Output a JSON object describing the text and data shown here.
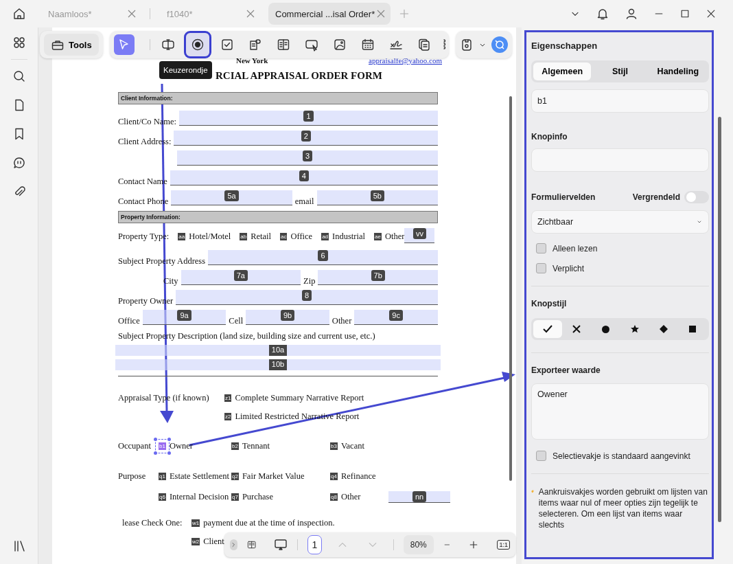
{
  "tabs": [
    {
      "label": "Naamloos*",
      "selected": false
    },
    {
      "label": "f1040*",
      "selected": false
    },
    {
      "label": "Commercial ...isal Order*",
      "selected": true
    }
  ],
  "toolbar": {
    "tools_label": "Tools",
    "items": [
      {
        "kind": "select",
        "selected": true,
        "highlighted": false
      },
      {
        "kind": "text-field",
        "selected": false,
        "highlighted": false
      },
      {
        "kind": "radio",
        "selected": false,
        "highlighted": true
      },
      {
        "kind": "checkbox",
        "selected": false,
        "highlighted": false
      },
      {
        "kind": "combo",
        "selected": false,
        "highlighted": false
      },
      {
        "kind": "list",
        "selected": false,
        "highlighted": false
      },
      {
        "kind": "button",
        "selected": false,
        "highlighted": false
      },
      {
        "kind": "image",
        "selected": false,
        "highlighted": false
      },
      {
        "kind": "date",
        "selected": false,
        "highlighted": false
      },
      {
        "kind": "signature",
        "selected": false,
        "highlighted": false
      },
      {
        "kind": "pages",
        "selected": false,
        "highlighted": false
      },
      {
        "kind": "cut",
        "selected": false,
        "highlighted": false
      }
    ]
  },
  "tooltip": "Keuzerondje",
  "document": {
    "city": "New York",
    "email": "appraisalfe@yahoo.com",
    "title": "RCIAL APPRAISAL ORDER FORM",
    "rows": [
      {
        "kind": "section",
        "label": "Client Information:"
      },
      {
        "kind": "fields",
        "items": [
          {
            "kind": "label",
            "text": "Client/Co Name:"
          },
          {
            "kind": "field",
            "tag": "1"
          }
        ]
      },
      {
        "kind": "fields",
        "items": [
          {
            "kind": "label",
            "text": "Client Address:"
          },
          {
            "kind": "field",
            "tag": "2"
          }
        ]
      },
      {
        "kind": "fields",
        "items": [
          {
            "kind": "field",
            "tag": "3"
          }
        ]
      },
      {
        "kind": "fields",
        "items": [
          {
            "kind": "label",
            "text": "Contact Name"
          },
          {
            "kind": "field",
            "tag": "4"
          }
        ]
      },
      {
        "kind": "fields",
        "items": [
          {
            "kind": "label",
            "text": "Contact Phone"
          },
          {
            "kind": "field",
            "tag": "5a"
          },
          {
            "kind": "label",
            "text": "email"
          },
          {
            "kind": "field",
            "tag": "5b"
          }
        ]
      },
      {
        "kind": "section",
        "label": "Property Information:"
      },
      {
        "kind": "inline",
        "label": "Property Type:",
        "items": [
          {
            "kind": "option",
            "tag": "aa",
            "text": "Hotel/Motel",
            "selected": false
          },
          {
            "kind": "option",
            "tag": "ab",
            "text": "Retail",
            "selected": false
          },
          {
            "kind": "option",
            "tag": "ac",
            "text": "Office",
            "selected": false
          },
          {
            "kind": "option",
            "tag": "ad",
            "text": "Industrial",
            "selected": false
          },
          {
            "kind": "option",
            "tag": "ae",
            "text": "Other",
            "selected": false
          },
          {
            "kind": "field",
            "tag": "vv"
          }
        ]
      },
      {
        "kind": "fields",
        "items": [
          {
            "kind": "label",
            "text": "Subject Property Address"
          },
          {
            "kind": "field",
            "tag": "6"
          }
        ]
      },
      {
        "kind": "fields-indented",
        "items": [
          {
            "kind": "label",
            "text": "City"
          },
          {
            "kind": "field",
            "tag": "7a"
          },
          {
            "kind": "label",
            "text": "Zip"
          },
          {
            "kind": "field",
            "tag": "7b"
          }
        ]
      },
      {
        "kind": "fields",
        "items": [
          {
            "kind": "label",
            "text": "Property Owner"
          },
          {
            "kind": "field",
            "tag": "8"
          }
        ]
      },
      {
        "kind": "fields",
        "items": [
          {
            "kind": "label",
            "text": "Office"
          },
          {
            "kind": "field",
            "tag": "9a"
          },
          {
            "kind": "label",
            "text": "Cell"
          },
          {
            "kind": "field",
            "tag": "9b"
          },
          {
            "kind": "label",
            "text": "Other"
          },
          {
            "kind": "field",
            "tag": "9c"
          }
        ]
      },
      {
        "kind": "text",
        "text": "Subject Property Description (land size, building size and current use, etc.)"
      },
      {
        "kind": "band",
        "tag": "10a"
      },
      {
        "kind": "band",
        "tag": "10b"
      },
      {
        "kind": "wide",
        "label": "Appraisal Type (if known)",
        "items": [
          {
            "kind": "option",
            "tag": "z1",
            "text": "Complete Summary Narrative Report",
            "selected": false
          }
        ]
      },
      {
        "kind": "wide",
        "items": [
          {
            "kind": "option",
            "tag": "z2",
            "text": "Limited Restricted Narrative Report",
            "selected": false
          }
        ]
      },
      {
        "kind": "grid",
        "label": "Occupant",
        "items": [
          {
            "kind": "option",
            "tag": "b1",
            "text": "Owner",
            "selected": true
          },
          {
            "kind": "option",
            "tag": "b2",
            "text": "Tennant",
            "selected": false
          },
          {
            "kind": "option",
            "tag": "b3",
            "text": "Vacant",
            "selected": false
          }
        ]
      },
      {
        "kind": "grid",
        "label": "Purpose",
        "items": [
          {
            "kind": "option",
            "tag": "q1",
            "text": "Estate Settlement",
            "selected": false
          },
          {
            "kind": "option",
            "tag": "q2",
            "text": "Fair Market Value",
            "selected": false
          },
          {
            "kind": "option",
            "tag": "q4",
            "text": "Refinance",
            "selected": false
          }
        ]
      },
      {
        "kind": "grid",
        "items": [
          {
            "kind": "option",
            "tag": "q6",
            "text": "Internal Decision",
            "selected": false
          },
          {
            "kind": "option",
            "tag": "q7",
            "text": "Purchase",
            "selected": false
          },
          {
            "kind": "option",
            "tag": "q8",
            "text": "Other",
            "selected": false
          },
          {
            "kind": "field",
            "tag": "nn"
          }
        ]
      },
      {
        "kind": "check",
        "label": "lease Check One:",
        "items": [
          {
            "kind": "option",
            "tag": "w1",
            "text": "payment due at the time of inspection.",
            "selected": false
          }
        ]
      },
      {
        "kind": "check",
        "items": [
          {
            "kind": "option",
            "tag": "w2",
            "text": "Client",
            "selected": false
          }
        ]
      }
    ]
  },
  "bottom_bar": {
    "page": "1",
    "zoom": "80%",
    "fit": "1:1"
  },
  "panel": {
    "title": "Eigenschappen",
    "tabs": [
      {
        "label": "Algemeen",
        "selected": true
      },
      {
        "label": "Stijl",
        "selected": false
      },
      {
        "label": "Handeling",
        "selected": false
      }
    ],
    "name_value": "b1",
    "tooltip_label": "Knopinfo",
    "form_fields_label": "Formuliervelden",
    "lock_label": "Vergrendeld",
    "locked": false,
    "visibility": "Zichtbaar",
    "checks": [
      {
        "label": "Alleen lezen",
        "checked": false
      },
      {
        "label": "Verplicht",
        "checked": false
      }
    ],
    "style_label": "Knopstijl",
    "styles": [
      {
        "kind": "check",
        "selected": true
      },
      {
        "kind": "cross",
        "selected": false
      },
      {
        "kind": "circle",
        "selected": false
      },
      {
        "kind": "star",
        "selected": false
      },
      {
        "kind": "diamond",
        "selected": false
      },
      {
        "kind": "square",
        "selected": false
      }
    ],
    "export_label": "Exporteer waarde",
    "export_value": "Owener",
    "default_check": {
      "label": "Selectievakje is standaard aangevinkt",
      "checked": false
    },
    "hint": "Aankruisvakjes worden gebruikt om lijsten van items waar nul of meer opties zijn tegelijk te selecteren. Om een lijst van items waar slechts"
  }
}
